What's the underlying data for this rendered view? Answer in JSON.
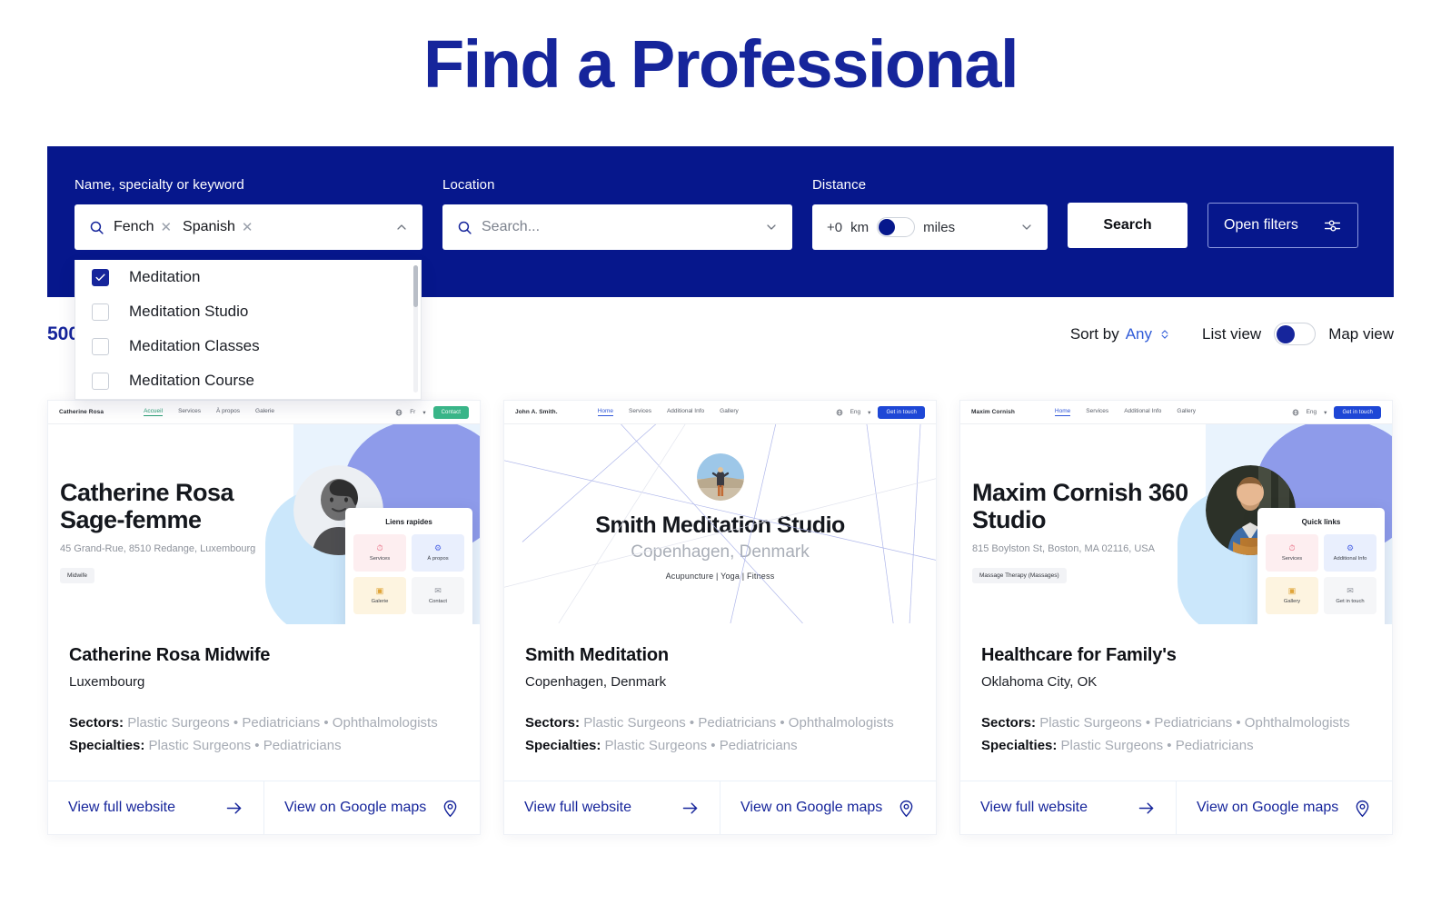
{
  "page_title": "Find a Professional",
  "theme": {
    "banner_blue": "#06178c",
    "title_blue": "#16259b",
    "link_blue": "#2f5bd8"
  },
  "search": {
    "keyword": {
      "label": "Name, specialty or keyword",
      "icon": "search-icon",
      "chips": [
        "Fench",
        "Spanish"
      ],
      "caret": "chevron-up-icon"
    },
    "location": {
      "label": "Location",
      "icon": "search-icon",
      "placeholder": "Search...",
      "value": "",
      "caret": "chevron-down-icon"
    },
    "distance": {
      "label": "Distance",
      "value": "+0",
      "unit_left": "km",
      "unit_right": "miles",
      "toggle_position": "left",
      "caret": "chevron-down-icon"
    },
    "search_button": "Search",
    "filters_button": "Open filters",
    "filters_icon": "sliders-icon"
  },
  "dropdown": {
    "options": [
      {
        "label": "Meditation",
        "checked": true
      },
      {
        "label": "Meditation Studio",
        "checked": false
      },
      {
        "label": "Meditation Classes",
        "checked": false
      },
      {
        "label": "Meditation Course",
        "checked": false
      }
    ]
  },
  "results_bar": {
    "count": "500",
    "sort_label": "Sort by",
    "sort_value": "Any",
    "sort_icon": "chevron-up-down-icon",
    "list_view_label": "List view",
    "map_view_label": "Map view",
    "view_toggle_position": "left"
  },
  "cards": [
    {
      "preview": {
        "layout": "left",
        "brand": "Catherine Rosa",
        "links": [
          "Accueil",
          "Services",
          "À propos",
          "Galerie"
        ],
        "active_link": "Accueil",
        "active_color": "green",
        "lang": "Fr",
        "cta": "Contact",
        "cta_color": "green",
        "headline": "Catherine Rosa\nSage-femme",
        "address": "45 Grand-Rue, 8510 Redange, Luxembourg",
        "tag": "Midwife",
        "quick_title": "Liens rapides",
        "tiles": [
          "Services",
          "À propos",
          "Galerie",
          "Contact"
        ]
      },
      "name": "Catherine Rosa Midwife",
      "location": "Luxembourg",
      "sectors_label": "Sectors:",
      "sectors": "Plastic Surgeons • Pediatricians • Ophthalmologists",
      "specialties_label": "Specialties:",
      "specialties": "Plastic Surgeons • Pediatricians",
      "website_button": "View full website",
      "maps_button": "View on Google maps"
    },
    {
      "preview": {
        "layout": "center",
        "brand": "John A. Smith.",
        "links": [
          "Home",
          "Services",
          "Additional Info",
          "Gallery"
        ],
        "active_link": "Home",
        "active_color": "blue",
        "lang": "Eng",
        "cta": "Get in touch",
        "cta_color": "blue",
        "headline": "Smith Meditation Studio",
        "subline": "Copenhagen, Denmark",
        "tags_line": "Acupuncture | Yoga | Fitness"
      },
      "name": "Smith Meditation",
      "location": "Copenhagen, Denmark",
      "sectors_label": "Sectors:",
      "sectors": "Plastic Surgeons • Pediatricians • Ophthalmologists",
      "specialties_label": "Specialties:",
      "specialties": "Plastic Surgeons • Pediatricians",
      "website_button": "View full website",
      "maps_button": "View on Google maps"
    },
    {
      "preview": {
        "layout": "left",
        "brand": "Maxim Cornish",
        "links": [
          "Home",
          "Services",
          "Additional Info",
          "Gallery"
        ],
        "active_link": "Home",
        "active_color": "blue",
        "lang": "Eng",
        "cta": "Get in touch",
        "cta_color": "blue",
        "headline": "Maxim Cornish 360\nStudio",
        "address": "815 Boylston St, Boston, MA 02116, USA",
        "tag": "Massage Therapy (Massages)",
        "quick_title": "Quick links",
        "tiles": [
          "Services",
          "Additional Info",
          "Gallery",
          "Get in touch"
        ]
      },
      "name": "Healthcare for Family's",
      "location": "Oklahoma City, OK",
      "sectors_label": "Sectors:",
      "sectors": "Plastic Surgeons • Pediatricians • Ophthalmologists",
      "specialties_label": "Specialties:",
      "specialties": "Plastic Surgeons • Pediatricians",
      "website_button": "View full website",
      "maps_button": "View on Google maps"
    }
  ]
}
